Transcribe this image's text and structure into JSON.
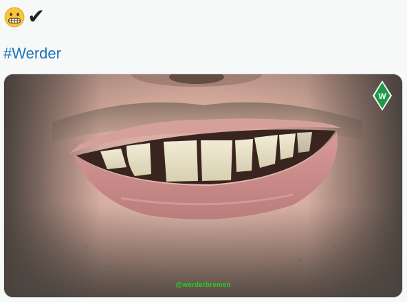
{
  "tweet": {
    "emojis": [
      {
        "icon": "grimacing-face-icon"
      },
      {
        "icon": "check-mark-icon",
        "glyph": "✔"
      }
    ],
    "hashtag": "#Werder",
    "colors": {
      "hashtag": "#1b73b6",
      "background": "#f7f9f9",
      "watermark": "#2ad11d",
      "crest_green": "#1d9a46"
    },
    "media": {
      "watermark_text": "@werderbremen",
      "crest_letter": "W",
      "crest_icon": "werder-bremen-crest-icon"
    }
  }
}
